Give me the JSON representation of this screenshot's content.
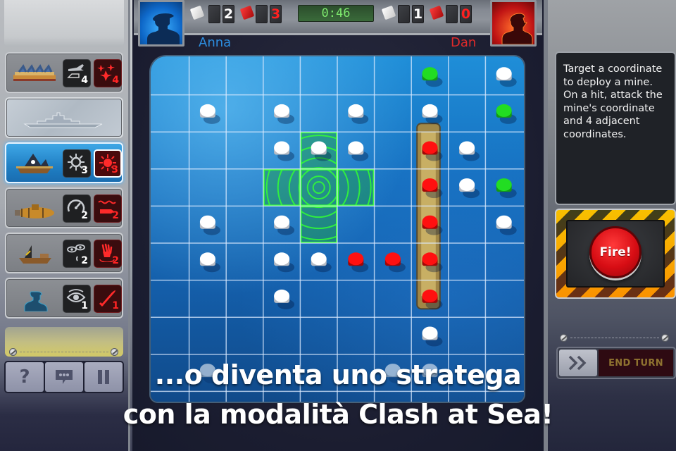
{
  "hud": {
    "player_left": {
      "name": "Anna",
      "white_score": "2",
      "red_score": "3",
      "color": "#2c8ee0"
    },
    "player_right": {
      "name": "Dan",
      "white_score": "1",
      "red_score": "0",
      "color": "#e02a2a"
    },
    "timer": "0:46"
  },
  "left_panel": {
    "ships": [
      {
        "name": "carrier",
        "state": "normal",
        "ability1": {
          "icon": "aircraft-icon",
          "count": "4"
        },
        "ability2": {
          "icon": "fighter-squadron-icon",
          "count": "4"
        }
      },
      {
        "name": "battleship",
        "state": "sunk"
      },
      {
        "name": "pirate-ship",
        "state": "active",
        "ability1": {
          "icon": "mine-icon",
          "count": "3"
        },
        "ability2": {
          "icon": "mine-attack-icon",
          "count": "3"
        }
      },
      {
        "name": "submarine",
        "state": "normal",
        "ability1": {
          "icon": "sonar-gauge-icon",
          "count": "2"
        },
        "ability2": {
          "icon": "torpedo-icon",
          "count": "2"
        }
      },
      {
        "name": "junk-ship",
        "state": "normal",
        "ability1": {
          "icon": "eyes-icon",
          "count": "2"
        },
        "ability2": {
          "icon": "grab-hand-icon",
          "count": "2"
        }
      },
      {
        "name": "commander",
        "state": "normal",
        "ability1": {
          "icon": "spy-eye-icon",
          "count": "1"
        },
        "ability2": {
          "icon": "missile-icon",
          "count": "1"
        }
      }
    ],
    "buttons": [
      {
        "name": "help",
        "label": "?"
      },
      {
        "name": "chat",
        "label": ""
      },
      {
        "name": "pause",
        "label": ""
      }
    ]
  },
  "right_panel": {
    "info_text": "Target a coordinate to deploy a mine. On a hit, attack the mine's coordinate and 4 adjacent coordinates.",
    "fire_label": "Fire!",
    "end_turn_label": "END TURN"
  },
  "board": {
    "columns": 10,
    "rows": 9,
    "colors": {
      "miss": "#ffffff",
      "hit": "#ff1010",
      "reveal": "#22dd22",
      "target": "#33ff33"
    },
    "target_cells": [
      [
        4,
        2
      ],
      [
        3,
        3
      ],
      [
        4,
        3
      ],
      [
        5,
        3
      ],
      [
        4,
        4
      ]
    ],
    "target_center": [
      4,
      3
    ],
    "enemy_ship": {
      "col": 7,
      "row_start": 2,
      "row_end": 6
    },
    "pegs": [
      {
        "c": 7,
        "r": 0,
        "t": "reveal"
      },
      {
        "c": 9,
        "r": 0,
        "t": "miss"
      },
      {
        "c": 1,
        "r": 1,
        "t": "miss"
      },
      {
        "c": 3,
        "r": 1,
        "t": "miss"
      },
      {
        "c": 5,
        "r": 1,
        "t": "miss"
      },
      {
        "c": 7,
        "r": 1,
        "t": "miss"
      },
      {
        "c": 9,
        "r": 1,
        "t": "reveal"
      },
      {
        "c": 3,
        "r": 2,
        "t": "miss"
      },
      {
        "c": 4,
        "r": 2,
        "t": "miss"
      },
      {
        "c": 5,
        "r": 2,
        "t": "miss"
      },
      {
        "c": 7,
        "r": 2,
        "t": "hit"
      },
      {
        "c": 8,
        "r": 2,
        "t": "miss"
      },
      {
        "c": 7,
        "r": 3,
        "t": "hit"
      },
      {
        "c": 8,
        "r": 3,
        "t": "miss"
      },
      {
        "c": 9,
        "r": 3,
        "t": "reveal"
      },
      {
        "c": 1,
        "r": 4,
        "t": "miss"
      },
      {
        "c": 3,
        "r": 4,
        "t": "miss"
      },
      {
        "c": 7,
        "r": 4,
        "t": "hit"
      },
      {
        "c": 9,
        "r": 4,
        "t": "miss"
      },
      {
        "c": 1,
        "r": 5,
        "t": "miss"
      },
      {
        "c": 3,
        "r": 5,
        "t": "miss"
      },
      {
        "c": 4,
        "r": 5,
        "t": "miss"
      },
      {
        "c": 5,
        "r": 5,
        "t": "hit"
      },
      {
        "c": 6,
        "r": 5,
        "t": "hit"
      },
      {
        "c": 7,
        "r": 5,
        "t": "hit"
      },
      {
        "c": 3,
        "r": 6,
        "t": "miss"
      },
      {
        "c": 7,
        "r": 6,
        "t": "hit"
      },
      {
        "c": 7,
        "r": 7,
        "t": "miss"
      },
      {
        "c": 1,
        "r": 8,
        "t": "miss"
      },
      {
        "c": 6,
        "r": 8,
        "t": "miss"
      },
      {
        "c": 7,
        "r": 8,
        "t": "miss"
      }
    ]
  },
  "caption": {
    "line1": "...o diventa uno stratega",
    "line2": "con la modalità Clash at Sea!"
  }
}
